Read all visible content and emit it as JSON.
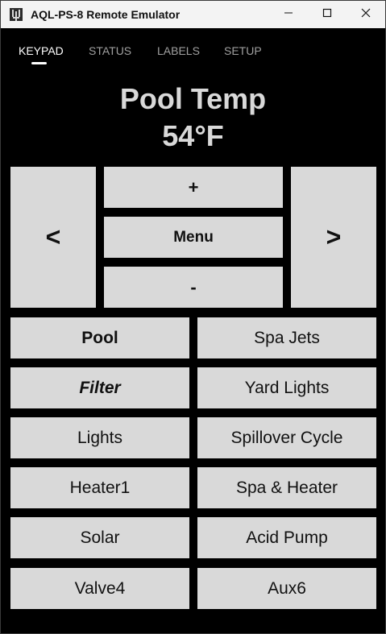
{
  "window": {
    "title": "AQL-PS-8 Remote Emulator"
  },
  "tabs": [
    {
      "label": "KEYPAD",
      "active": true
    },
    {
      "label": "STATUS",
      "active": false
    },
    {
      "label": "LABELS",
      "active": false
    },
    {
      "label": "SETUP",
      "active": false
    }
  ],
  "display": {
    "line1": "Pool Temp",
    "line2": "54°F"
  },
  "nav": {
    "left": "<",
    "right": ">",
    "plus": "+",
    "menu": "Menu",
    "minus": "-"
  },
  "function_buttons": [
    {
      "label": "Pool"
    },
    {
      "label": "Spa Jets"
    },
    {
      "label": "Filter"
    },
    {
      "label": "Yard Lights"
    },
    {
      "label": "Lights"
    },
    {
      "label": "Spillover Cycle"
    },
    {
      "label": "Heater1"
    },
    {
      "label": "Spa & Heater"
    },
    {
      "label": "Solar"
    },
    {
      "label": "Acid Pump"
    },
    {
      "label": "Valve4"
    },
    {
      "label": "Aux6"
    }
  ],
  "colors": {
    "background": "#000000",
    "button": "#d9d9d9",
    "button_text": "#111111",
    "display_text": "#d9d9d9",
    "tab_active": "#ffffff",
    "tab_inactive": "#a0a0a0",
    "titlebar": "#f3f3f3"
  },
  "icons": {
    "app": "cable-plug-icon",
    "minimize": "minimize-icon",
    "maximize": "maximize-icon",
    "close": "close-icon"
  }
}
